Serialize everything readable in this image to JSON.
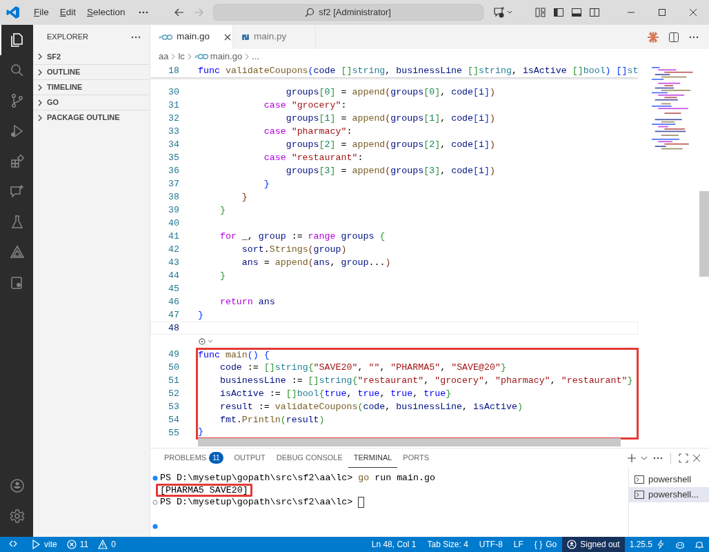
{
  "title_bar": {
    "menu": [
      "File",
      "Edit",
      "Selection"
    ],
    "search": "sf2 [Administrator]"
  },
  "activity_bar": [
    {
      "kind": "files",
      "selected": true
    },
    {
      "kind": "search",
      "selected": false
    },
    {
      "kind": "branch",
      "selected": false
    },
    {
      "kind": "debug",
      "selected": false
    },
    {
      "kind": "extensions",
      "selected": false
    },
    {
      "kind": "chat",
      "selected": false
    },
    {
      "kind": "flask",
      "selected": false
    },
    {
      "kind": "triangle",
      "selected": false
    },
    {
      "kind": "remote",
      "selected": false
    }
  ],
  "sidebar": {
    "title": "EXPLORER",
    "sections": [
      {
        "label": "SF2",
        "expanded": false
      },
      {
        "label": "OUTLINE",
        "expanded": false
      },
      {
        "label": "TIMELINE",
        "expanded": false
      },
      {
        "label": "GO",
        "expanded": false
      },
      {
        "label": "PACKAGE OUTLINE",
        "expanded": false
      }
    ]
  },
  "tabs": [
    {
      "label": "main.go",
      "kind": "go",
      "selected": true
    },
    {
      "label": "main.py",
      "kind": "python",
      "selected": false
    }
  ],
  "breadcrumb": [
    {
      "label": "aa",
      "kind": "folder"
    },
    {
      "label": "lc",
      "kind": "folder"
    },
    {
      "label": "main.go",
      "kind": "go"
    },
    {
      "label": "...",
      "kind": "folder"
    }
  ],
  "sticky_line": {
    "number": "18",
    "tokens": [
      {
        "kind": "d",
        "text": "func "
      },
      {
        "kind": "f",
        "text": "validateCoupons"
      },
      {
        "kind": "b1",
        "text": "("
      },
      {
        "kind": "v",
        "text": "code "
      },
      {
        "kind": "b2",
        "text": "[]"
      },
      {
        "kind": "t",
        "text": "string"
      },
      {
        "kind": "p",
        "text": ", "
      },
      {
        "kind": "v",
        "text": "businessLine "
      },
      {
        "kind": "b2",
        "text": "[]"
      },
      {
        "kind": "t",
        "text": "string"
      },
      {
        "kind": "p",
        "text": ", "
      },
      {
        "kind": "v",
        "text": "isActive "
      },
      {
        "kind": "b2",
        "text": "[]"
      },
      {
        "kind": "t",
        "text": "bool"
      },
      {
        "kind": "b1",
        "text": ") "
      },
      {
        "kind": "b1",
        "text": "[]"
      },
      {
        "kind": "t",
        "text": "st"
      }
    ]
  },
  "code_lines": [
    {
      "number": "30",
      "current": false,
      "highlighted": false,
      "tokens": [
        {
          "kind": "v",
          "text": "                groups"
        },
        {
          "kind": "b2",
          "text": "["
        },
        {
          "kind": "n",
          "text": "0"
        },
        {
          "kind": "b2",
          "text": "]"
        },
        {
          "kind": "p",
          "text": " = "
        },
        {
          "kind": "f",
          "text": "append"
        },
        {
          "kind": "b3",
          "text": "("
        },
        {
          "kind": "v",
          "text": "groups"
        },
        {
          "kind": "b2",
          "text": "["
        },
        {
          "kind": "n",
          "text": "0"
        },
        {
          "kind": "b2",
          "text": "]"
        },
        {
          "kind": "p",
          "text": ", "
        },
        {
          "kind": "v",
          "text": "code"
        },
        {
          "kind": "b1",
          "text": "["
        },
        {
          "kind": "v",
          "text": "i"
        },
        {
          "kind": "b1",
          "text": "]"
        },
        {
          "kind": "b3",
          "text": ")"
        }
      ]
    },
    {
      "number": "31",
      "current": false,
      "highlighted": false,
      "tokens": [
        {
          "kind": "k",
          "text": "            case "
        },
        {
          "kind": "s",
          "text": "\"grocery\""
        },
        {
          "kind": "p",
          "text": ":"
        }
      ]
    },
    {
      "number": "32",
      "current": false,
      "highlighted": false,
      "tokens": [
        {
          "kind": "v",
          "text": "                groups"
        },
        {
          "kind": "b2",
          "text": "["
        },
        {
          "kind": "n",
          "text": "1"
        },
        {
          "kind": "b2",
          "text": "]"
        },
        {
          "kind": "p",
          "text": " = "
        },
        {
          "kind": "f",
          "text": "append"
        },
        {
          "kind": "b3",
          "text": "("
        },
        {
          "kind": "v",
          "text": "groups"
        },
        {
          "kind": "b2",
          "text": "["
        },
        {
          "kind": "n",
          "text": "1"
        },
        {
          "kind": "b2",
          "text": "]"
        },
        {
          "kind": "p",
          "text": ", "
        },
        {
          "kind": "v",
          "text": "code"
        },
        {
          "kind": "b1",
          "text": "["
        },
        {
          "kind": "v",
          "text": "i"
        },
        {
          "kind": "b1",
          "text": "]"
        },
        {
          "kind": "b3",
          "text": ")"
        }
      ]
    },
    {
      "number": "33",
      "current": false,
      "highlighted": false,
      "tokens": [
        {
          "kind": "k",
          "text": "            case "
        },
        {
          "kind": "s",
          "text": "\"pharmacy\""
        },
        {
          "kind": "p",
          "text": ":"
        }
      ]
    },
    {
      "number": "34",
      "current": false,
      "highlighted": false,
      "tokens": [
        {
          "kind": "v",
          "text": "                groups"
        },
        {
          "kind": "b2",
          "text": "["
        },
        {
          "kind": "n",
          "text": "2"
        },
        {
          "kind": "b2",
          "text": "]"
        },
        {
          "kind": "p",
          "text": " = "
        },
        {
          "kind": "f",
          "text": "append"
        },
        {
          "kind": "b3",
          "text": "("
        },
        {
          "kind": "v",
          "text": "groups"
        },
        {
          "kind": "b2",
          "text": "["
        },
        {
          "kind": "n",
          "text": "2"
        },
        {
          "kind": "b2",
          "text": "]"
        },
        {
          "kind": "p",
          "text": ", "
        },
        {
          "kind": "v",
          "text": "code"
        },
        {
          "kind": "b1",
          "text": "["
        },
        {
          "kind": "v",
          "text": "i"
        },
        {
          "kind": "b1",
          "text": "]"
        },
        {
          "kind": "b3",
          "text": ")"
        }
      ]
    },
    {
      "number": "35",
      "current": false,
      "highlighted": false,
      "tokens": [
        {
          "kind": "k",
          "text": "            case "
        },
        {
          "kind": "s",
          "text": "\"restaurant\""
        },
        {
          "kind": "p",
          "text": ":"
        }
      ]
    },
    {
      "number": "36",
      "current": false,
      "highlighted": false,
      "tokens": [
        {
          "kind": "v",
          "text": "                groups"
        },
        {
          "kind": "b2",
          "text": "["
        },
        {
          "kind": "n",
          "text": "3"
        },
        {
          "kind": "b2",
          "text": "]"
        },
        {
          "kind": "p",
          "text": " = "
        },
        {
          "kind": "f",
          "text": "append"
        },
        {
          "kind": "b3",
          "text": "("
        },
        {
          "kind": "v",
          "text": "groups"
        },
        {
          "kind": "b2",
          "text": "["
        },
        {
          "kind": "n",
          "text": "3"
        },
        {
          "kind": "b2",
          "text": "]"
        },
        {
          "kind": "p",
          "text": ", "
        },
        {
          "kind": "v",
          "text": "code"
        },
        {
          "kind": "b1",
          "text": "["
        },
        {
          "kind": "v",
          "text": "i"
        },
        {
          "kind": "b1",
          "text": "]"
        },
        {
          "kind": "b3",
          "text": ")"
        }
      ]
    },
    {
      "number": "37",
      "current": false,
      "highlighted": false,
      "tokens": [
        {
          "kind": "b1",
          "text": "            }"
        }
      ]
    },
    {
      "number": "38",
      "current": false,
      "highlighted": false,
      "tokens": [
        {
          "kind": "b3",
          "text": "        }"
        }
      ]
    },
    {
      "number": "39",
      "current": false,
      "highlighted": false,
      "tokens": [
        {
          "kind": "b2",
          "text": "    }"
        }
      ]
    },
    {
      "number": "40",
      "current": false
    },
    {
      "number": "41",
      "current": false,
      "highlighted": false,
      "tokens": [
        {
          "kind": "k",
          "text": "    for"
        },
        {
          "kind": "p",
          "text": " _, "
        },
        {
          "kind": "v",
          "text": "group"
        },
        {
          "kind": "p",
          "text": " := "
        },
        {
          "kind": "k",
          "text": "range "
        },
        {
          "kind": "v",
          "text": "groups "
        },
        {
          "kind": "b2",
          "text": "{"
        }
      ]
    },
    {
      "number": "42",
      "current": false,
      "highlighted": false,
      "tokens": [
        {
          "kind": "v",
          "text": "        sort"
        },
        {
          "kind": "p",
          "text": "."
        },
        {
          "kind": "f",
          "text": "Strings"
        },
        {
          "kind": "b3",
          "text": "("
        },
        {
          "kind": "v",
          "text": "group"
        },
        {
          "kind": "b3",
          "text": ")"
        }
      ]
    },
    {
      "number": "43",
      "current": false,
      "highlighted": false,
      "tokens": [
        {
          "kind": "v",
          "text": "        ans"
        },
        {
          "kind": "p",
          "text": " = "
        },
        {
          "kind": "f",
          "text": "append"
        },
        {
          "kind": "b3",
          "text": "("
        },
        {
          "kind": "v",
          "text": "ans"
        },
        {
          "kind": "p",
          "text": ", "
        },
        {
          "kind": "v",
          "text": "group"
        },
        {
          "kind": "p",
          "text": "..."
        },
        {
          "kind": "b3",
          "text": ")"
        }
      ]
    },
    {
      "number": "44",
      "current": false,
      "highlighted": false,
      "tokens": [
        {
          "kind": "b2",
          "text": "    }"
        }
      ]
    },
    {
      "number": "45",
      "current": false
    },
    {
      "number": "46",
      "current": false,
      "highlighted": false,
      "tokens": [
        {
          "kind": "k",
          "text": "    return "
        },
        {
          "kind": "v",
          "text": "ans"
        }
      ]
    },
    {
      "number": "47",
      "current": false,
      "highlighted": false,
      "tokens": [
        {
          "kind": "b1",
          "text": "}"
        }
      ]
    },
    {
      "number": "48",
      "current": true
    },
    {
      "kind": "codelens"
    },
    {
      "number": "49",
      "current": false,
      "highlighted": true,
      "tokens": [
        {
          "kind": "d",
          "text": "func "
        },
        {
          "kind": "f",
          "text": "main"
        },
        {
          "kind": "b1",
          "text": "() {"
        }
      ]
    },
    {
      "number": "50",
      "current": false,
      "highlighted": true,
      "tokens": [
        {
          "kind": "v",
          "text": "    code"
        },
        {
          "kind": "p",
          "text": " := "
        },
        {
          "kind": "b2",
          "text": "[]"
        },
        {
          "kind": "t",
          "text": "string"
        },
        {
          "kind": "b2",
          "text": "{"
        },
        {
          "kind": "s",
          "text": "\"SAVE20\""
        },
        {
          "kind": "p",
          "text": ", "
        },
        {
          "kind": "s",
          "text": "\"\""
        },
        {
          "kind": "p",
          "text": ", "
        },
        {
          "kind": "s",
          "text": "\"PHARMA5\""
        },
        {
          "kind": "p",
          "text": ", "
        },
        {
          "kind": "s",
          "text": "\"SAVE@20\""
        },
        {
          "kind": "b2",
          "text": "}"
        }
      ]
    },
    {
      "number": "51",
      "current": false,
      "highlighted": true,
      "tokens": [
        {
          "kind": "v",
          "text": "    businessLine"
        },
        {
          "kind": "p",
          "text": " := "
        },
        {
          "kind": "b2",
          "text": "[]"
        },
        {
          "kind": "t",
          "text": "string"
        },
        {
          "kind": "b2",
          "text": "{"
        },
        {
          "kind": "s",
          "text": "\"restaurant\""
        },
        {
          "kind": "p",
          "text": ", "
        },
        {
          "kind": "s",
          "text": "\"grocery\""
        },
        {
          "kind": "p",
          "text": ", "
        },
        {
          "kind": "s",
          "text": "\"pharmacy\""
        },
        {
          "kind": "p",
          "text": ", "
        },
        {
          "kind": "s",
          "text": "\"restaurant\""
        },
        {
          "kind": "b2",
          "text": "}"
        }
      ]
    },
    {
      "number": "52",
      "current": false,
      "highlighted": true,
      "tokens": [
        {
          "kind": "v",
          "text": "    isActive"
        },
        {
          "kind": "p",
          "text": " := "
        },
        {
          "kind": "b2",
          "text": "[]"
        },
        {
          "kind": "t",
          "text": "bool"
        },
        {
          "kind": "b2",
          "text": "{"
        },
        {
          "kind": "d",
          "text": "true"
        },
        {
          "kind": "p",
          "text": ", "
        },
        {
          "kind": "d",
          "text": "true"
        },
        {
          "kind": "p",
          "text": ", "
        },
        {
          "kind": "d",
          "text": "true"
        },
        {
          "kind": "p",
          "text": ", "
        },
        {
          "kind": "d",
          "text": "true"
        },
        {
          "kind": "b2",
          "text": "}"
        }
      ]
    },
    {
      "number": "53",
      "current": false,
      "highlighted": true,
      "tokens": [
        {
          "kind": "v",
          "text": "    result"
        },
        {
          "kind": "p",
          "text": " := "
        },
        {
          "kind": "f",
          "text": "validateCoupons"
        },
        {
          "kind": "b2",
          "text": "("
        },
        {
          "kind": "v",
          "text": "code"
        },
        {
          "kind": "p",
          "text": ", "
        },
        {
          "kind": "v",
          "text": "businessLine"
        },
        {
          "kind": "p",
          "text": ", "
        },
        {
          "kind": "v",
          "text": "isActive"
        },
        {
          "kind": "b2",
          "text": ")"
        }
      ]
    },
    {
      "number": "54",
      "current": false,
      "highlighted": true,
      "tokens": [
        {
          "kind": "v",
          "text": "    fmt"
        },
        {
          "kind": "p",
          "text": "."
        },
        {
          "kind": "f",
          "text": "Println"
        },
        {
          "kind": "b2",
          "text": "("
        },
        {
          "kind": "v",
          "text": "result"
        },
        {
          "kind": "b2",
          "text": ")"
        }
      ]
    },
    {
      "number": "55",
      "current": false,
      "highlighted": true,
      "tokens": [
        {
          "kind": "b1",
          "text": "}"
        }
      ]
    }
  ],
  "panel": {
    "tabs": [
      {
        "label": "PROBLEMS",
        "badge": "11",
        "selected": false
      },
      {
        "label": "OUTPUT",
        "selected": false
      },
      {
        "label": "DEBUG CONSOLE",
        "selected": false
      },
      {
        "label": "TERMINAL",
        "selected": true
      },
      {
        "label": "PORTS",
        "selected": false
      }
    ],
    "terminal_lines": [
      {
        "kind": "command",
        "tokens": [
          {
            "kind": "p",
            "text": "PS D:\\mysetup\\gopath\\src\\sf2\\aa\\lc> "
          },
          {
            "kind": "c",
            "text": "go"
          },
          {
            "kind": "p",
            "text": " run main.go"
          }
        ]
      },
      {
        "kind": "output",
        "highlighted": true,
        "tokens": [
          {
            "kind": "p",
            "text": "[PHARMA5 SAVE20]"
          }
        ]
      },
      {
        "kind": "prompt",
        "cursor": true,
        "tokens": [
          {
            "kind": "p",
            "text": "PS D:\\mysetup\\gopath\\src\\sf2\\aa\\lc> "
          }
        ]
      },
      {
        "kind": "blank"
      },
      {
        "kind": "command"
      }
    ],
    "terminals": [
      {
        "label": "powershell",
        "selected": false
      },
      {
        "label": "powershell...",
        "selected": true
      }
    ]
  },
  "status_bar": {
    "left": [
      {
        "kind": "remote"
      },
      {
        "kind": "run",
        "text": "vite"
      },
      {
        "kind": "errors",
        "text": "11"
      },
      {
        "kind": "warnings",
        "text": "0"
      }
    ],
    "right": [
      {
        "kind": "text",
        "text": "Ln 48, Col 1"
      },
      {
        "kind": "text",
        "text": "Tab Size: 4"
      },
      {
        "kind": "text",
        "text": "UTF-8"
      },
      {
        "kind": "text",
        "text": "LF"
      },
      {
        "kind": "language",
        "glyph": "{ }",
        "text": "Go"
      },
      {
        "kind": "account",
        "text": "Signed out"
      },
      {
        "kind": "version",
        "text": "1.25.5"
      },
      {
        "kind": "copilot"
      },
      {
        "kind": "bell"
      }
    ]
  }
}
